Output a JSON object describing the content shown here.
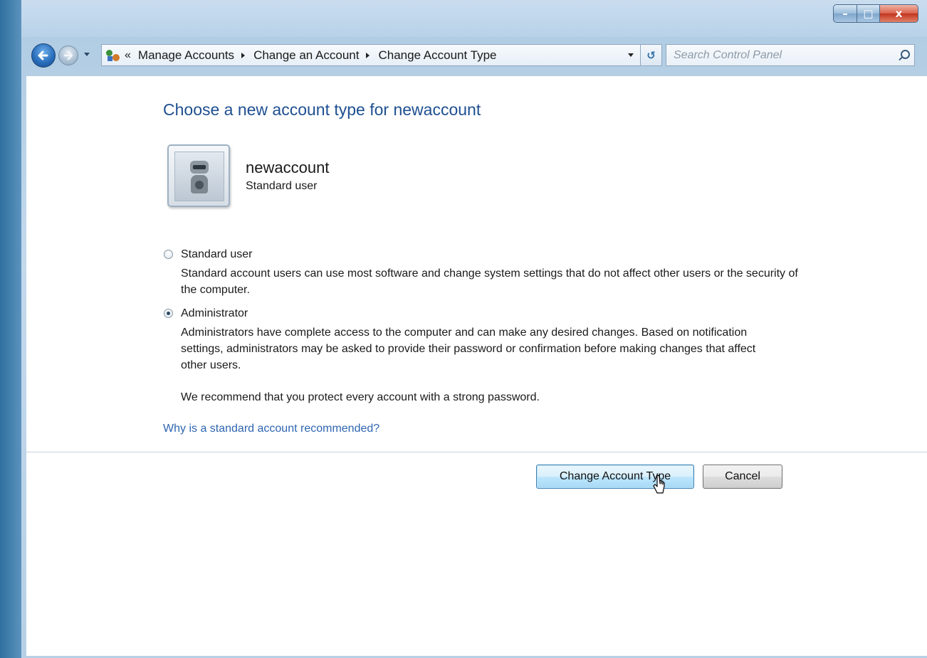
{
  "window": {
    "caption_buttons": {
      "minimize": "–",
      "maximize": "□",
      "close": "x"
    }
  },
  "nav": {
    "overflow_chevron": "«",
    "breadcrumbs": [
      {
        "label": "Manage Accounts"
      },
      {
        "label": "Change an Account"
      },
      {
        "label": "Change Account Type"
      }
    ],
    "refresh_glyph": "↺",
    "search_placeholder": "Search Control Panel"
  },
  "page": {
    "title": "Choose a new account type for newaccount",
    "account": {
      "name": "newaccount",
      "role": "Standard user"
    },
    "options": [
      {
        "label": "Standard user",
        "description": "Standard account users can use most software and change system settings that do not affect other users or the security of the computer.",
        "selected": false
      },
      {
        "label": "Administrator",
        "description": "Administrators have complete access to the computer and can make any desired changes. Based on notification settings, administrators may be asked to provide their password or confirmation before making changes that affect other users.",
        "selected": true
      }
    ],
    "recommendation": "We recommend that you protect every account with a strong password.",
    "help_link": "Why is a standard account recommended?",
    "buttons": {
      "primary": "Change Account Type",
      "cancel": "Cancel"
    }
  },
  "colors": {
    "title_blue": "#1e4f91",
    "link_blue": "#2e65b0",
    "primary_button_border": "#3c7fb1"
  },
  "icons": [
    "back-arrow-icon",
    "forward-arrow-icon",
    "users-icon",
    "search-icon",
    "refresh-icon",
    "user-robot-avatar",
    "mouse-cursor-icon"
  ]
}
